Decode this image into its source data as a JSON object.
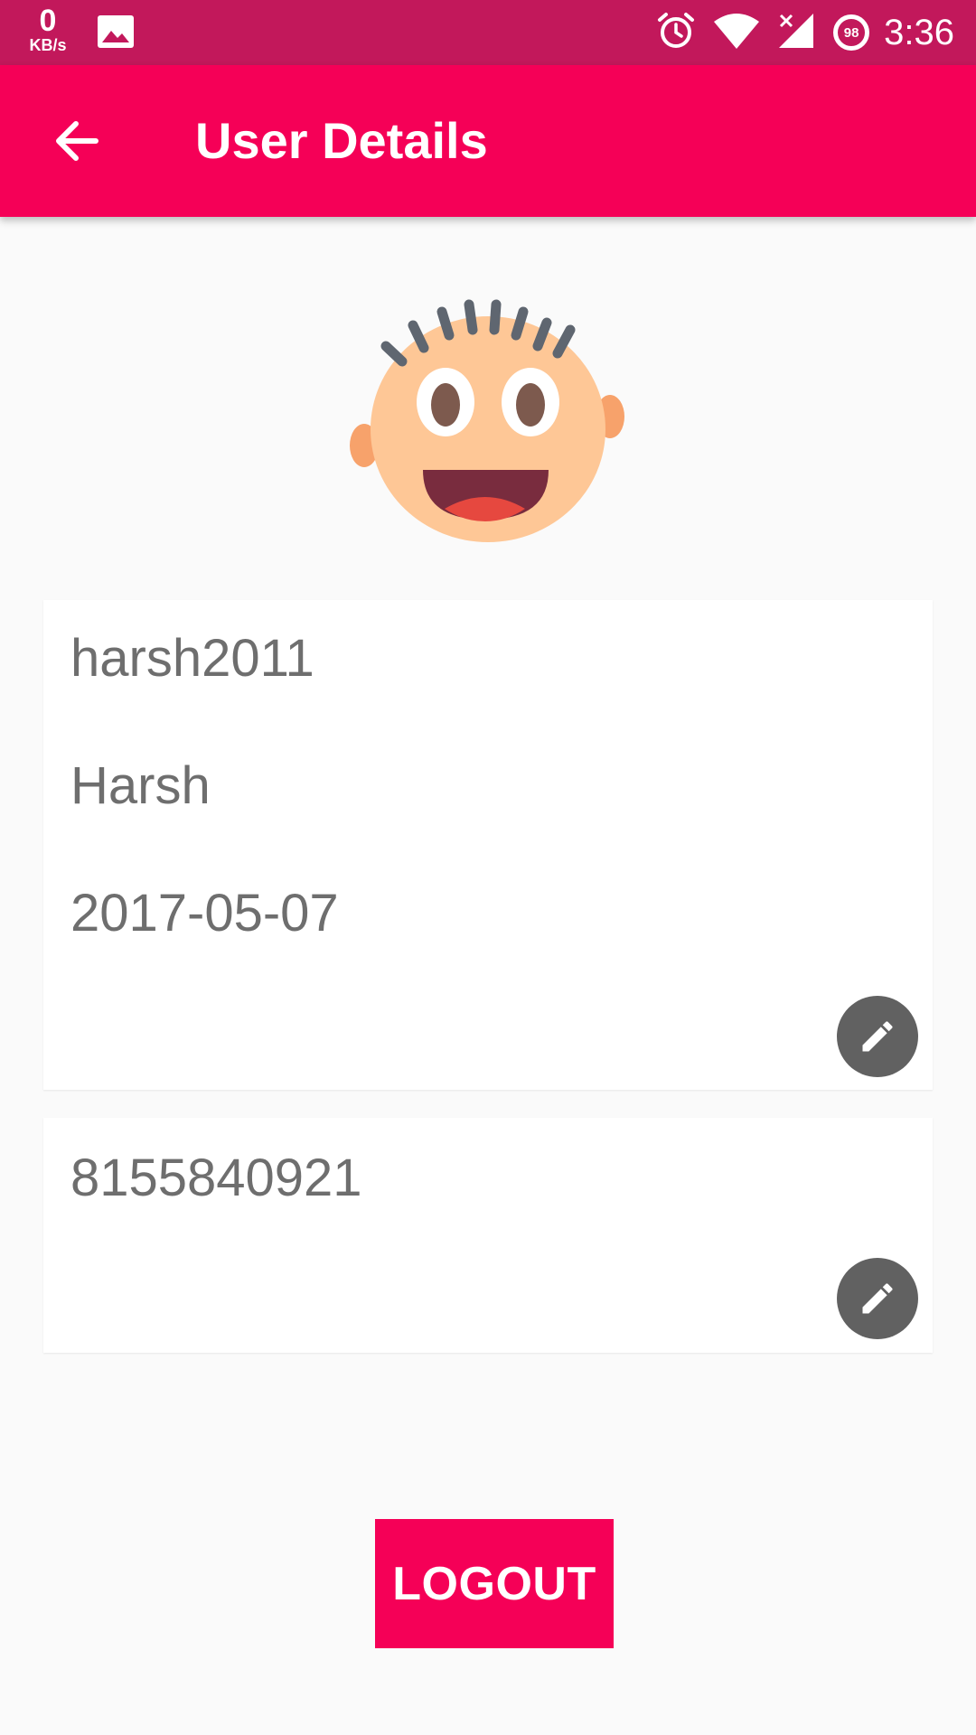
{
  "status_bar": {
    "net_speed_value": "0",
    "net_speed_unit": "KB/s",
    "battery_level": "98",
    "time": "3:36",
    "icons": [
      "image-icon",
      "alarm-icon",
      "wifi-icon",
      "signal-icon",
      "battery-icon"
    ]
  },
  "app_bar": {
    "title": "User Details",
    "back_icon": "arrow-back-icon",
    "color": "#f50057"
  },
  "profile": {
    "avatar_icon": "cartoon-face-avatar"
  },
  "details_card": {
    "username": "harsh2011",
    "name": "Harsh",
    "date": "2017-05-07",
    "edit_icon": "pencil-icon"
  },
  "phone_card": {
    "phone": "8155840921",
    "edit_icon": "pencil-icon"
  },
  "logout_button": {
    "label": "LOGOUT"
  }
}
